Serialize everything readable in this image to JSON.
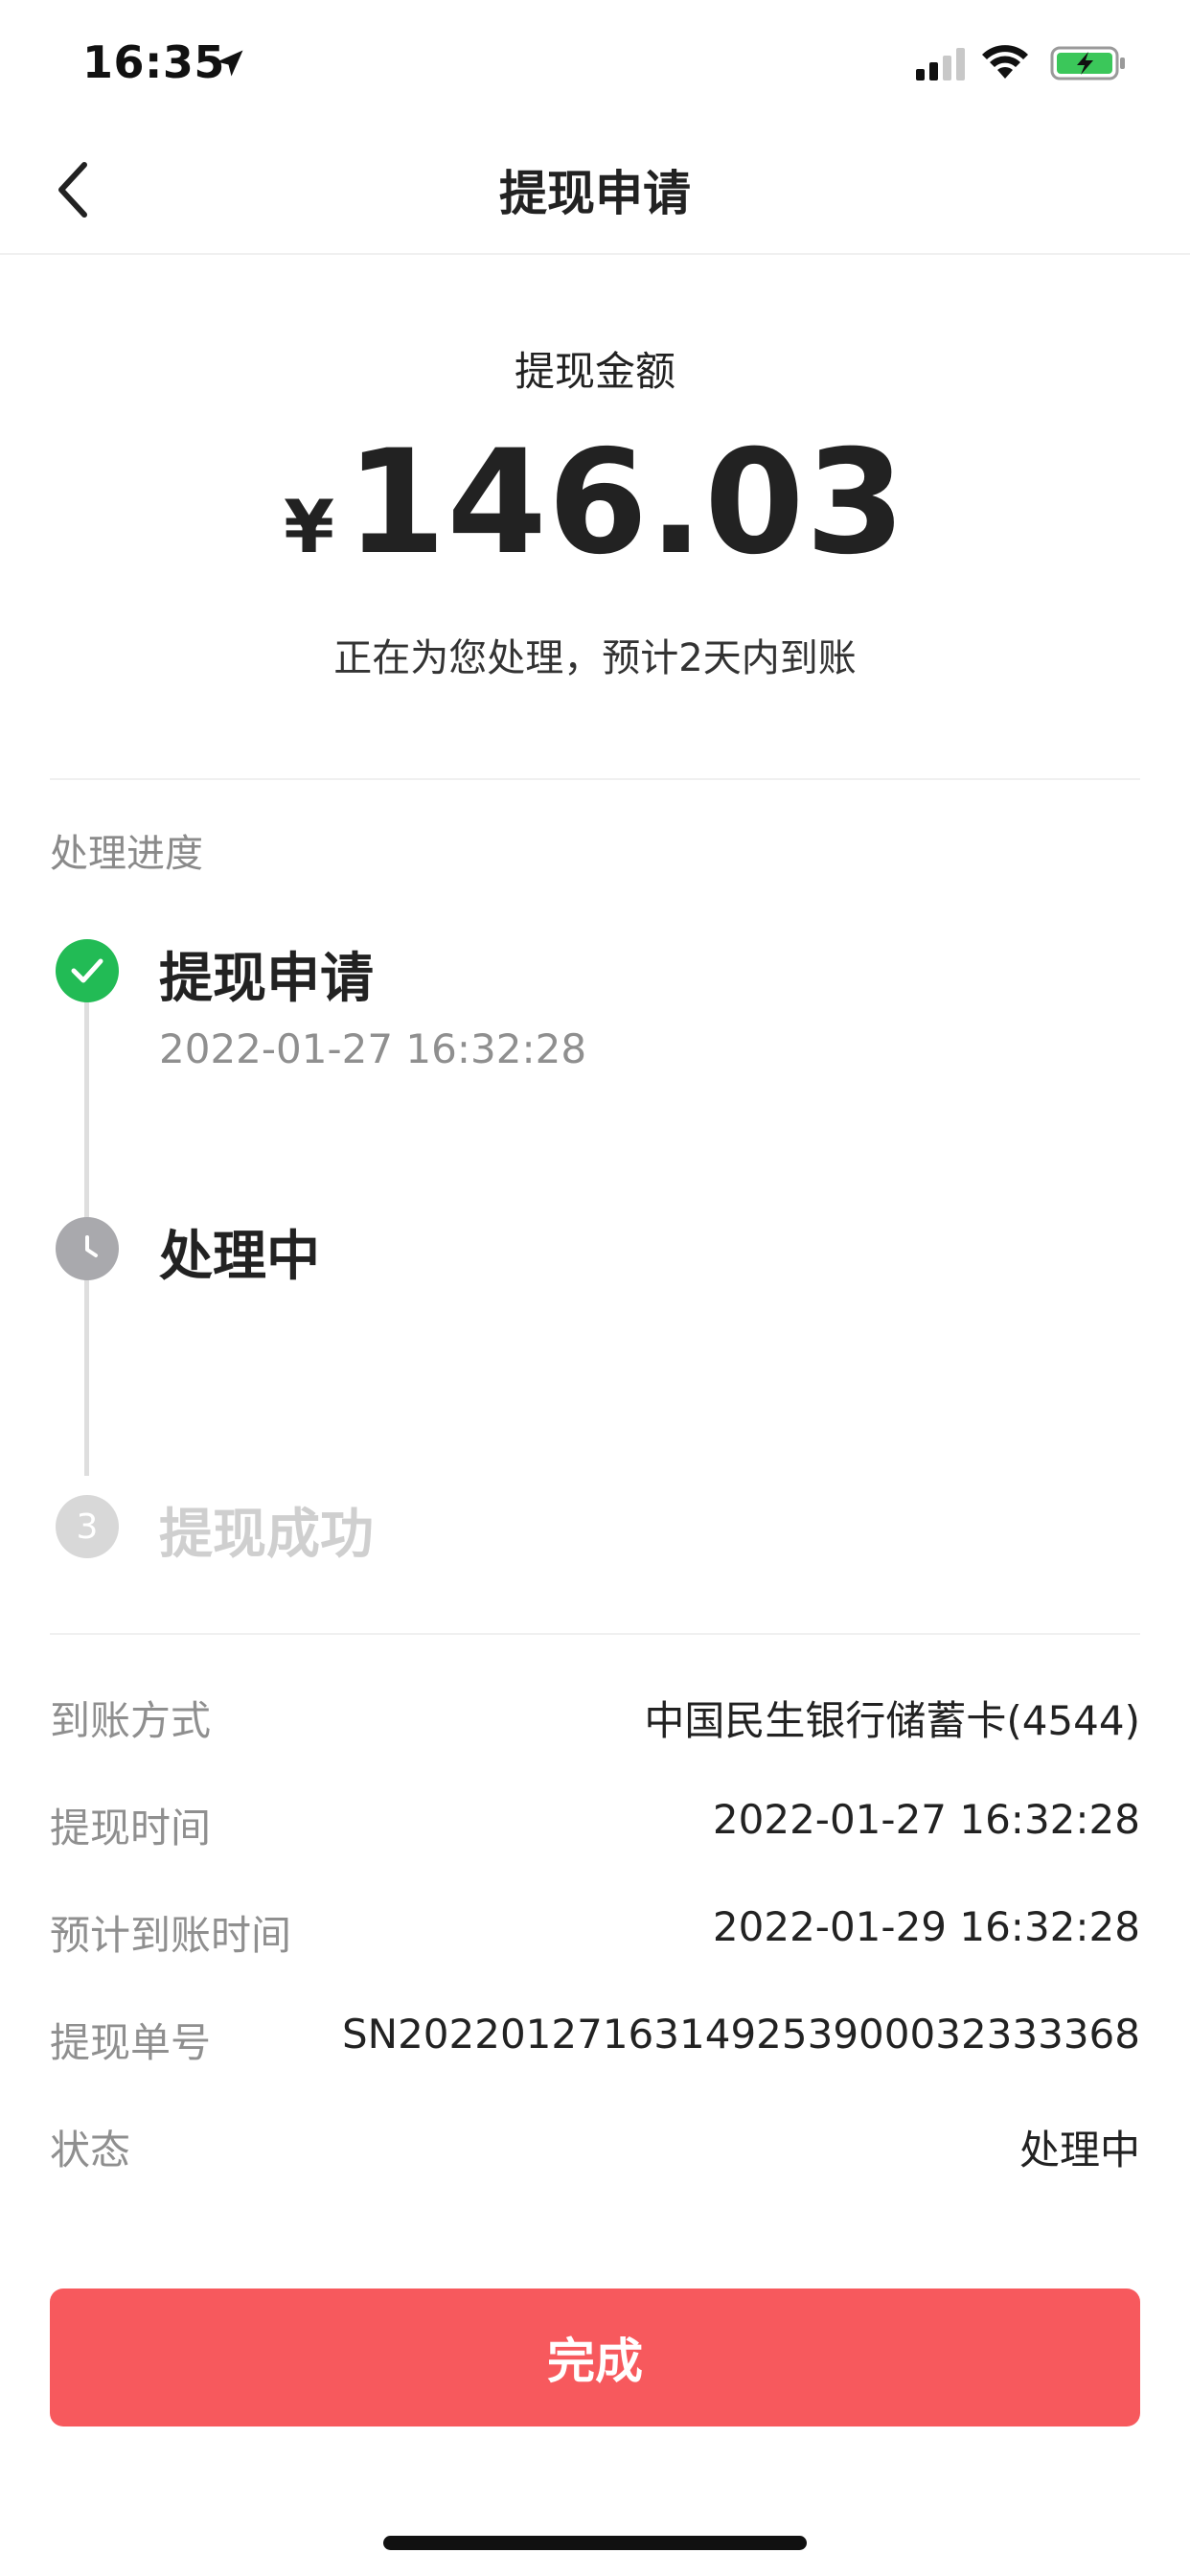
{
  "status_bar": {
    "time": "16:35",
    "battery_color": "#3bc75a"
  },
  "nav": {
    "title": "提现申请"
  },
  "amount": {
    "label": "提现金额",
    "currency": "¥",
    "value": "146.03",
    "note": "正在为您处理，预计2天内到账"
  },
  "progress": {
    "heading": "处理进度",
    "steps": [
      {
        "title": "提现申请",
        "time": "2022-01-27 16:32:28",
        "state": "done"
      },
      {
        "title": "处理中",
        "state": "current"
      },
      {
        "title": "提现成功",
        "number": "3",
        "state": "pending"
      }
    ]
  },
  "details": [
    {
      "label": "到账方式",
      "value": "中国民生银行储蓄卡(4544)"
    },
    {
      "label": "提现时间",
      "value": "2022-01-27 16:32:28"
    },
    {
      "label": "预计到账时间",
      "value": "2022-01-29 16:32:28"
    },
    {
      "label": "提现单号",
      "value": "SN20220127163149253900032333368"
    },
    {
      "label": "状态",
      "value": "处理中"
    }
  ],
  "button": {
    "label": "完成",
    "color": "#f7595d"
  },
  "colors": {
    "success": "#22bb55",
    "current": "#a9a9ad",
    "pending": "#d8d8d8"
  }
}
